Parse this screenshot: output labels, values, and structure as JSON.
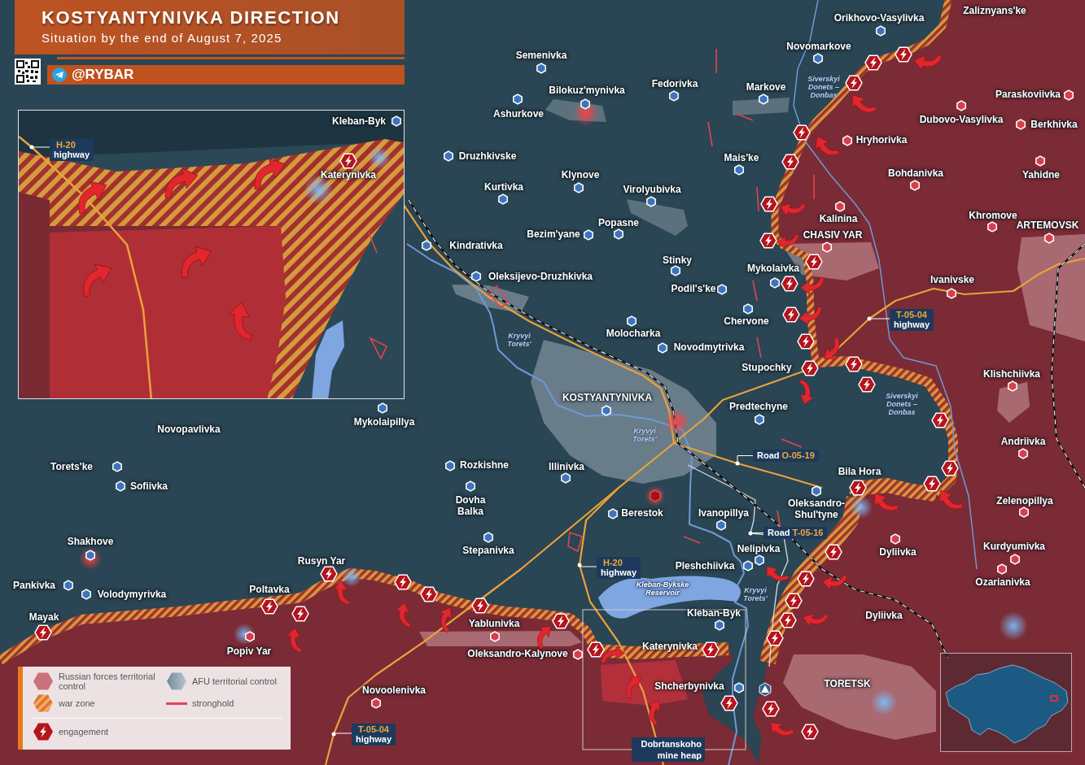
{
  "header": {
    "title": "KOSTYANTYNIVKA DIRECTION",
    "subtitle": "Situation by the end of August 7, 2025",
    "channel": "@RYBAR"
  },
  "towns": [
    {
      "name": "Zaliznyans'ke"
    },
    {
      "name": "Orikhovo-Vasylivka",
      "color": "#3d74bd"
    },
    {
      "name": "Novomarkove",
      "color": "#3d74bd"
    },
    {
      "name": "Semenivka",
      "color": "#3d74bd"
    },
    {
      "name": "Bilokuz'mynivka",
      "color": "#3d74bd"
    },
    {
      "name": "Fedorivka",
      "color": "#3d74bd"
    },
    {
      "name": "Markove",
      "color": "#3d74bd"
    },
    {
      "name": "Paraskoviivka",
      "color": "#d63f4b"
    },
    {
      "name": "Ashurkove",
      "color": "#3d74bd"
    },
    {
      "name": "Dubovo-Vasylivka",
      "color": "#d63f4b"
    },
    {
      "name": "Berkhivka",
      "color": "#d63f4b"
    },
    {
      "name": "Hryhorivka",
      "color": "#d63f4b"
    },
    {
      "name": "Druzhkivske",
      "color": "#3d74bd"
    },
    {
      "name": "Mais'ke",
      "color": "#3d74bd"
    },
    {
      "name": "Klynove",
      "color": "#3d74bd"
    },
    {
      "name": "Bohdanivka",
      "color": "#d63f4b"
    },
    {
      "name": "Yahidne",
      "color": "#d63f4b"
    },
    {
      "name": "Kurtivka",
      "color": "#3d74bd"
    },
    {
      "name": "Virolyubivka",
      "color": "#3d74bd"
    },
    {
      "name": "Popasne",
      "color": "#3d74bd"
    },
    {
      "name": "Kalinina",
      "color": "#d63f4b"
    },
    {
      "name": "Khromove",
      "color": "#d63f4b"
    },
    {
      "name": "ARTEMOVSK",
      "color": "#d63f4b"
    },
    {
      "name": "Bezim'yane",
      "color": "#3d74bd"
    },
    {
      "name": "CHASIV YAR",
      "color": "#d63f4b"
    },
    {
      "name": "Kindrativka",
      "color": "#3d74bd"
    },
    {
      "name": "Stinky",
      "color": "#3d74bd"
    },
    {
      "name": "Mykolaivka",
      "color": "#3d74bd"
    },
    {
      "name": "Oleksijevo-Druzhkivka",
      "color": "#3d74bd"
    },
    {
      "name": "Ivanivske",
      "color": "#d63f4b"
    },
    {
      "name": "Podil's'ke",
      "color": "#3d74bd"
    },
    {
      "name": "Chervone",
      "color": "#3d74bd"
    },
    {
      "name": "Molocharka",
      "color": "#3d74bd"
    },
    {
      "name": "Novodmytrivka",
      "color": "#3d74bd"
    },
    {
      "name": "Stupochky"
    },
    {
      "name": "Klishchiivka",
      "color": "#d63f4b"
    },
    {
      "name": "KOSTYANTYNIVKA",
      "color": "#3d74bd"
    },
    {
      "name": "Predtechyne",
      "color": "#3d74bd"
    },
    {
      "name": "Mykolaipillya",
      "color": "#3d74bd"
    },
    {
      "name": "Novopavlivka"
    },
    {
      "name": "Andriivka",
      "color": "#d63f4b"
    },
    {
      "name": "Torets'ke",
      "color": "#3d74bd"
    },
    {
      "name": "Rozkishne",
      "color": "#3d74bd"
    },
    {
      "name": "Illinivka",
      "color": "#3d74bd"
    },
    {
      "name": "Bila Hora"
    },
    {
      "name": "Sofiivka",
      "color": "#3d74bd"
    },
    {
      "name": "Dovha Balka",
      "color": "#3d74bd"
    },
    {
      "name": "Berestok",
      "color": "#3d74bd"
    },
    {
      "name": "Ivanopillya",
      "color": "#3d74bd"
    },
    {
      "name": "Oleksandro-Shul'tyne",
      "color": "#3d74bd"
    },
    {
      "name": "Zelenopillya",
      "color": "#d63f4b"
    },
    {
      "name": "Shakhove",
      "color": "#3d74bd"
    },
    {
      "name": "Stepanivka",
      "color": "#3d74bd"
    },
    {
      "name": "Nelipivka",
      "color": "#3d74bd"
    },
    {
      "name": "Dyliivka",
      "color": "#d63f4b"
    },
    {
      "name": "Kurdyumivka",
      "color": "#d63f4b"
    },
    {
      "name": "Rusyn Yar"
    },
    {
      "name": "Pleshchiivka",
      "color": "#3d74bd"
    },
    {
      "name": "Pankivka",
      "color": "#3d74bd"
    },
    {
      "name": "Volodymyrivka",
      "color": "#3d74bd"
    },
    {
      "name": "Poltavka"
    },
    {
      "name": "Ozarianivka",
      "color": "#d63f4b"
    },
    {
      "name": "Mayak"
    },
    {
      "name": "Kleban-Byk",
      "color": "#3d74bd"
    },
    {
      "name": "Dyliivka"
    },
    {
      "name": "Yablunivka",
      "color": "#d63f4b"
    },
    {
      "name": "Popiv Yar",
      "color": "#d63f4b"
    },
    {
      "name": "Oleksandro-Kalynove",
      "color": "#d63f4b"
    },
    {
      "name": "Katerynivka"
    },
    {
      "name": "Novoolenivka",
      "color": "#d63f4b"
    },
    {
      "name": "Shcherbynivka",
      "color": "#3d74bd"
    },
    {
      "name": "TORETSK"
    }
  ],
  "roads": [
    {
      "kind": "highway",
      "code": "T-05-04",
      "label": "highway"
    },
    {
      "kind": "road",
      "code": "O-05-19",
      "label": "Road"
    },
    {
      "kind": "road",
      "code": "T-05-16",
      "label": "Road"
    },
    {
      "kind": "highway",
      "code": "H-20",
      "label": "highway"
    },
    {
      "kind": "highway",
      "code": "T-05-04",
      "label": "highway"
    }
  ],
  "waters": [
    {
      "name": "Siverskyi Donets – Donbas"
    },
    {
      "name": "Kryvyi Torets'"
    },
    {
      "name": "Siverskyi Donets – Donbas"
    },
    {
      "name": "Kryvyi Torets'"
    },
    {
      "name": "Kleban-Bykske Reservoir"
    },
    {
      "name": "Kryvyi Torets'"
    }
  ],
  "landmarks": [
    {
      "name": "Dobrtanskoho mine heap"
    }
  ],
  "inset": {
    "towns": [
      {
        "name": "Kleban-Byk",
        "color": "#3d74bd"
      },
      {
        "name": "Katerynivka"
      }
    ],
    "roads": [
      {
        "kind": "highway",
        "code": "H-20",
        "label": "highway"
      }
    ]
  },
  "legend": [
    {
      "kind": "russian",
      "label": "Russian forces territorial control"
    },
    {
      "kind": "afu",
      "label": "AFU territorial control"
    },
    {
      "kind": "warzone",
      "label": "war zone"
    },
    {
      "kind": "stronghold",
      "label": "stronghold"
    },
    {
      "kind": "engagement",
      "label": "engagement"
    }
  ]
}
